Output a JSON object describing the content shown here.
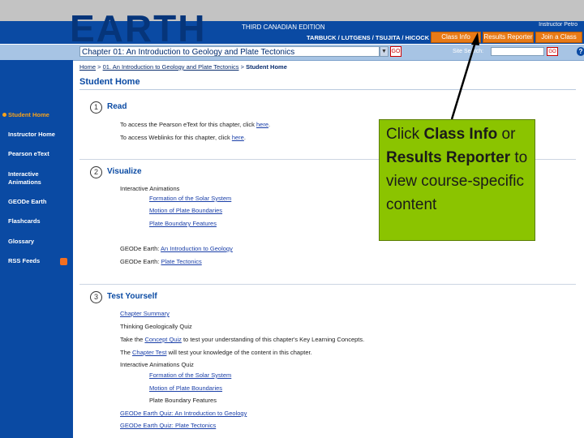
{
  "header": {
    "brand": "EARTH",
    "edition": "THIRD CANADIAN EDITION",
    "authors": "TARBUCK / LUTGENS / TSUJITA / HICOCK",
    "user_line1": "Instructor Petro",
    "buttons": {
      "class_info": "Class Info",
      "results_reporter": "Results Reporter",
      "join_class": "Join a Class"
    }
  },
  "chapter_bar": {
    "selected_chapter": "Chapter 01: An Introduction to Geology and Plate Tectonics",
    "go_label": "GO",
    "search_label": "Site Search:",
    "search_placeholder": "",
    "search_go": "GO",
    "help": "?"
  },
  "breadcrumb": {
    "home": "Home",
    "sep1": ">",
    "chapter": "01. An Introduction to Geology and Plate Tectonics",
    "sep2": ">",
    "current": "Student Home"
  },
  "sidebar": {
    "items": [
      {
        "label": "Student Home"
      },
      {
        "label": "Instructor Home"
      },
      {
        "label": "Pearson eText"
      },
      {
        "label": "Interactive Animations"
      },
      {
        "label": "GEODe Earth"
      },
      {
        "label": "Flashcards"
      },
      {
        "label": "Glossary"
      },
      {
        "label": "RSS Feeds"
      }
    ]
  },
  "main": {
    "title": "Student Home",
    "sections": [
      {
        "num": "1",
        "title": "Read",
        "lines": {
          "etext_pre": "To access the Pearson eText for this chapter, click ",
          "etext_link": "here",
          "weblinks_pre": "To access Weblinks for this chapter, click ",
          "weblinks_link": "here"
        }
      },
      {
        "num": "2",
        "title": "Visualize",
        "lines": {
          "anim_head": "Interactive Animations",
          "anim1": "Formation of the Solar System",
          "anim2": "Motion of Plate Boundaries",
          "anim3": "Plate Boundary Features",
          "geode1_pre": "GEODe Earth: ",
          "geode1_link": "An Introduction to Geology",
          "geode2_pre": "GEODe Earth: ",
          "geode2_link": "Plate Tectonics"
        }
      },
      {
        "num": "3",
        "title": "Test Yourself",
        "lines": {
          "summary": "Chapter Summary",
          "thinking": "Thinking Geologically Quiz",
          "concept_pre": "Take the ",
          "concept_link": "Concept Quiz",
          "concept_post": " to test your understanding of this chapter's Key Learning Concepts.",
          "test_pre": "The ",
          "test_link": "Chapter Test",
          "test_post": " will test your knowledge of the content in this chapter.",
          "iaq_head": "Interactive Animations Quiz",
          "iaq1": "Formation of the Solar System",
          "iaq2": "Motion of Plate Boundaries",
          "iaq3": "Plate Boundary Features",
          "gq1": "GEODe Earth Quiz: An Introduction to Geology",
          "gq2": "GEODe Earth Quiz: Plate Tectonics"
        }
      }
    ]
  },
  "callout": {
    "t1": "Click ",
    "b1": "Class Info",
    "t2": " or ",
    "b2": "Results Reporter",
    "t3": " to view course-specific content"
  },
  "colors": {
    "header": "#0a4aa3",
    "accent_orange": "#e87a16",
    "callout": "#8bc400"
  }
}
